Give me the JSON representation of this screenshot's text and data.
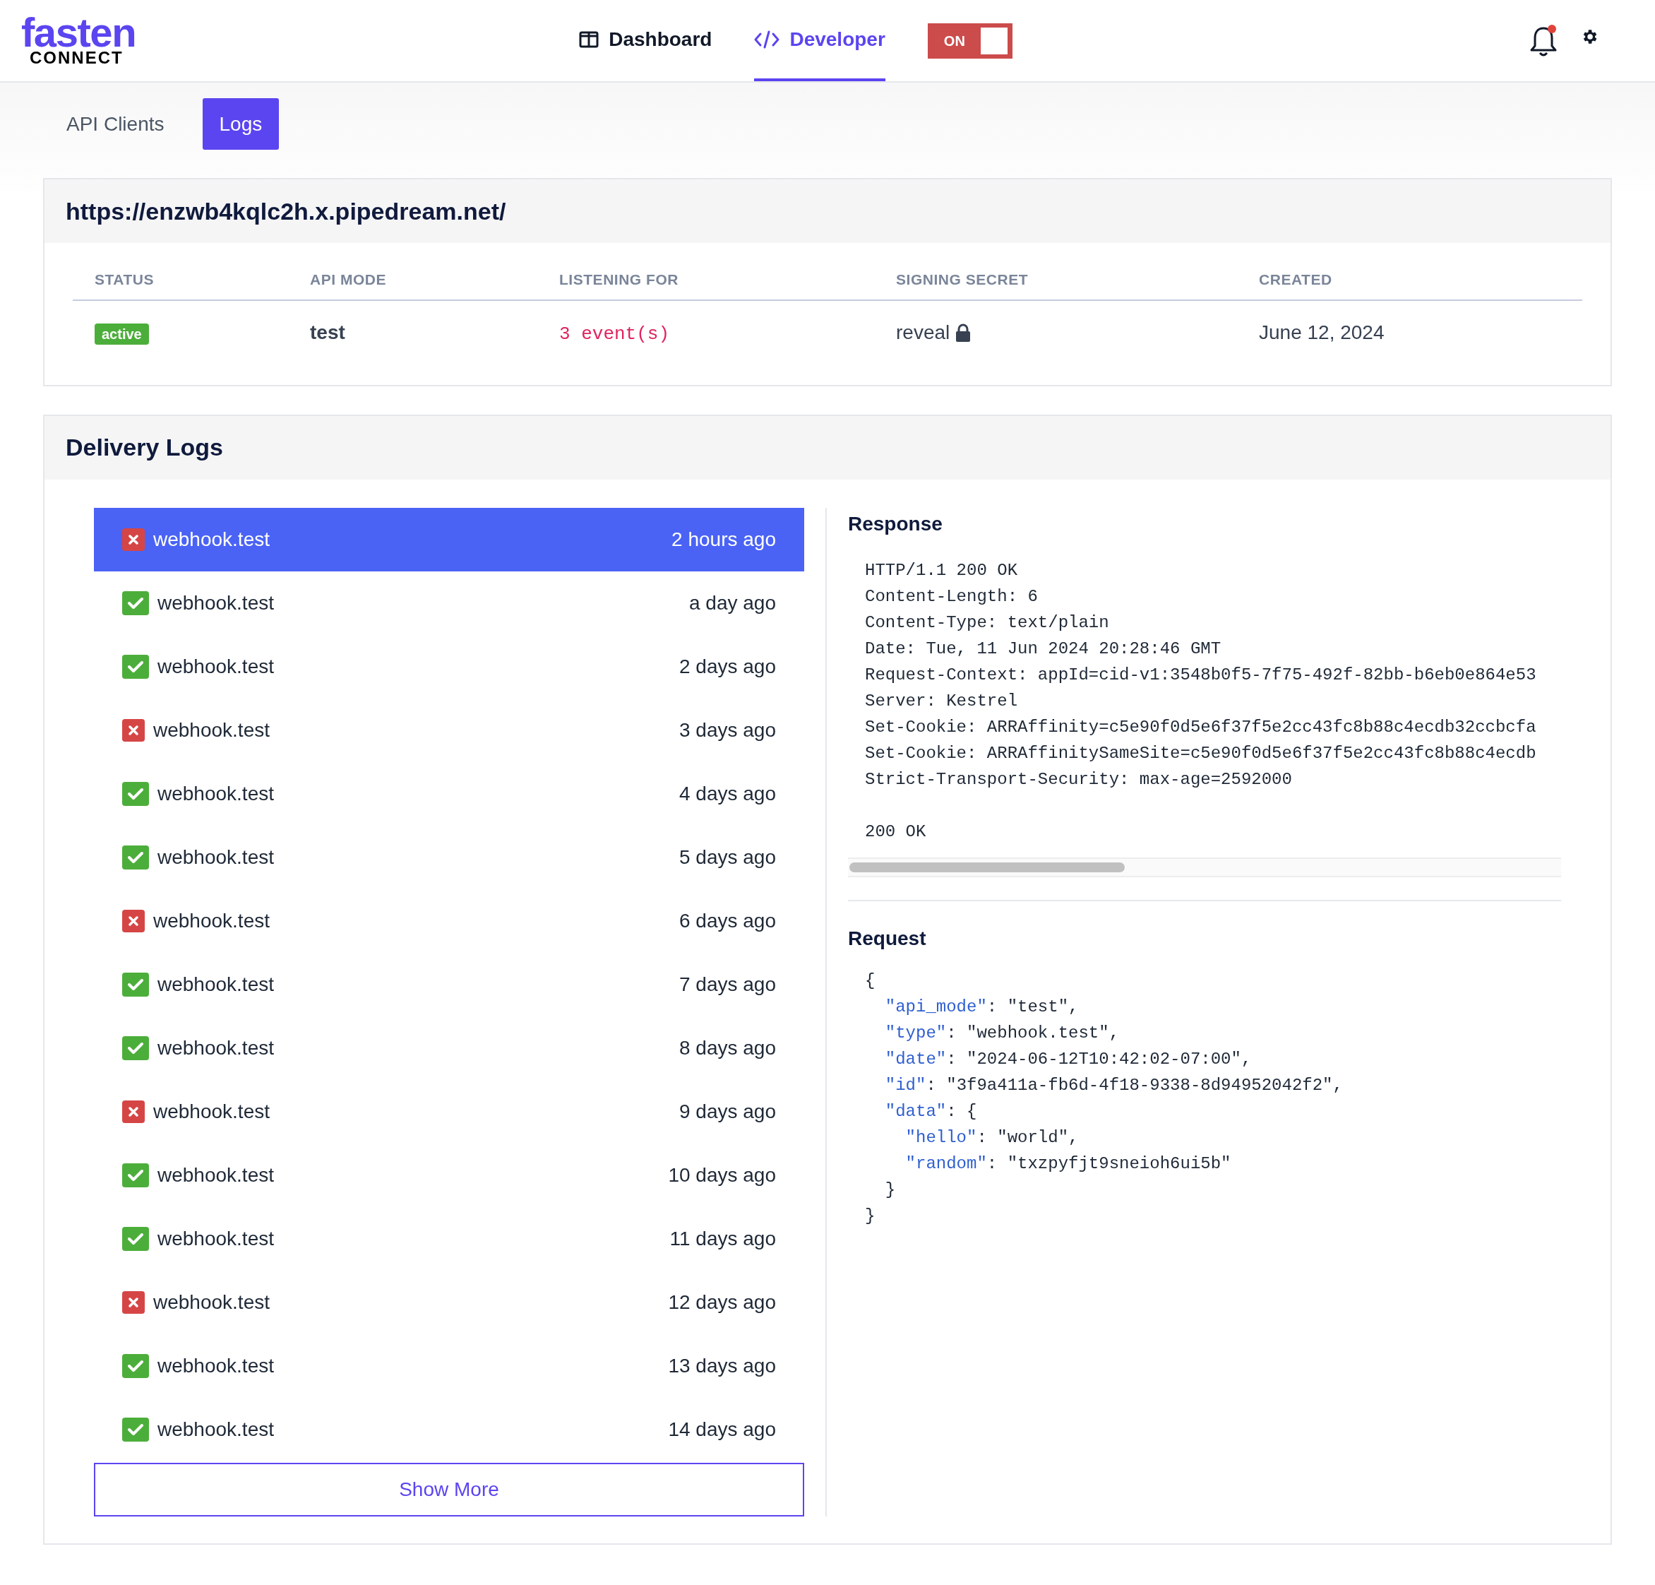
{
  "brand": {
    "name": "fasten",
    "sub": "CONNECT"
  },
  "nav": [
    {
      "label": "Dashboard",
      "kind": "dashboard",
      "selected": false
    },
    {
      "label": "Developer",
      "kind": "code",
      "selected": true
    }
  ],
  "toggle": {
    "label": "ON",
    "on": true
  },
  "notifications": {
    "unread": true
  },
  "subtabs": [
    {
      "label": "API Clients",
      "selected": false
    },
    {
      "label": "Logs",
      "selected": true
    }
  ],
  "endpoint": {
    "url": "https://enzwb4kqlc2h.x.pipedream.net/",
    "columns": [
      "STATUS",
      "API MODE",
      "LISTENING FOR",
      "SIGNING SECRET",
      "CREATED"
    ],
    "status": "active",
    "api_mode": "test",
    "listening_for": "3 event(s)",
    "signing_secret": "reveal",
    "created": "June 12, 2024"
  },
  "delivery_logs": {
    "title": "Delivery Logs",
    "items": [
      {
        "event": "webhook.test",
        "time": "2 hours ago",
        "kind": "failed",
        "selected": true
      },
      {
        "event": "webhook.test",
        "time": "a day ago",
        "kind": "success",
        "selected": false
      },
      {
        "event": "webhook.test",
        "time": "2 days ago",
        "kind": "success",
        "selected": false
      },
      {
        "event": "webhook.test",
        "time": "3 days ago",
        "kind": "failed",
        "selected": false
      },
      {
        "event": "webhook.test",
        "time": "4 days ago",
        "kind": "success",
        "selected": false
      },
      {
        "event": "webhook.test",
        "time": "5 days ago",
        "kind": "success",
        "selected": false
      },
      {
        "event": "webhook.test",
        "time": "6 days ago",
        "kind": "failed",
        "selected": false
      },
      {
        "event": "webhook.test",
        "time": "7 days ago",
        "kind": "success",
        "selected": false
      },
      {
        "event": "webhook.test",
        "time": "8 days ago",
        "kind": "success",
        "selected": false
      },
      {
        "event": "webhook.test",
        "time": "9 days ago",
        "kind": "failed",
        "selected": false
      },
      {
        "event": "webhook.test",
        "time": "10 days ago",
        "kind": "success",
        "selected": false
      },
      {
        "event": "webhook.test",
        "time": "11 days ago",
        "kind": "success",
        "selected": false
      },
      {
        "event": "webhook.test",
        "time": "12 days ago",
        "kind": "failed",
        "selected": false
      },
      {
        "event": "webhook.test",
        "time": "13 days ago",
        "kind": "success",
        "selected": false
      },
      {
        "event": "webhook.test",
        "time": "14 days ago",
        "kind": "success",
        "selected": false
      }
    ],
    "show_more": "Show More",
    "response_title": "Response",
    "response_lines": [
      "HTTP/1.1 200 OK",
      "Content-Length: 6",
      "Content-Type: text/plain",
      "Date: Tue, 11 Jun 2024 20:28:46 GMT",
      "Request-Context: appId=cid-v1:3548b0f5-7f75-492f-82bb-b6eb0e864e53",
      "Server: Kestrel",
      "Set-Cookie: ARRAffinity=c5e90f0d5e6f37f5e2cc43fc8b88c4ecdb32ccbcfa",
      "Set-Cookie: ARRAffinitySameSite=c5e90f0d5e6f37f5e2cc43fc8b88c4ecdb",
      "Strict-Transport-Security: max-age=2592000"
    ],
    "response_body": "200 OK",
    "request_title": "Request",
    "request_lines": [
      {
        "text": "{"
      },
      {
        "key": "  \"api_mode\"",
        "text": ": \"test\","
      },
      {
        "key": "  \"type\"",
        "text": ": \"webhook.test\","
      },
      {
        "key": "  \"date\"",
        "text": ": \"2024-06-12T10:42:02-07:00\","
      },
      {
        "key": "  \"id\"",
        "text": ": \"3f9a411a-fb6d-4f18-9338-8d94952042f2\","
      },
      {
        "key": "  \"data\"",
        "text": ": {"
      },
      {
        "key": "    \"hello\"",
        "text": ": \"world\","
      },
      {
        "key": "    \"random\"",
        "text": ": \"txzpyfjt9sneioh6ui5b\""
      },
      {
        "text": "  }"
      },
      {
        "text": "}"
      }
    ]
  }
}
